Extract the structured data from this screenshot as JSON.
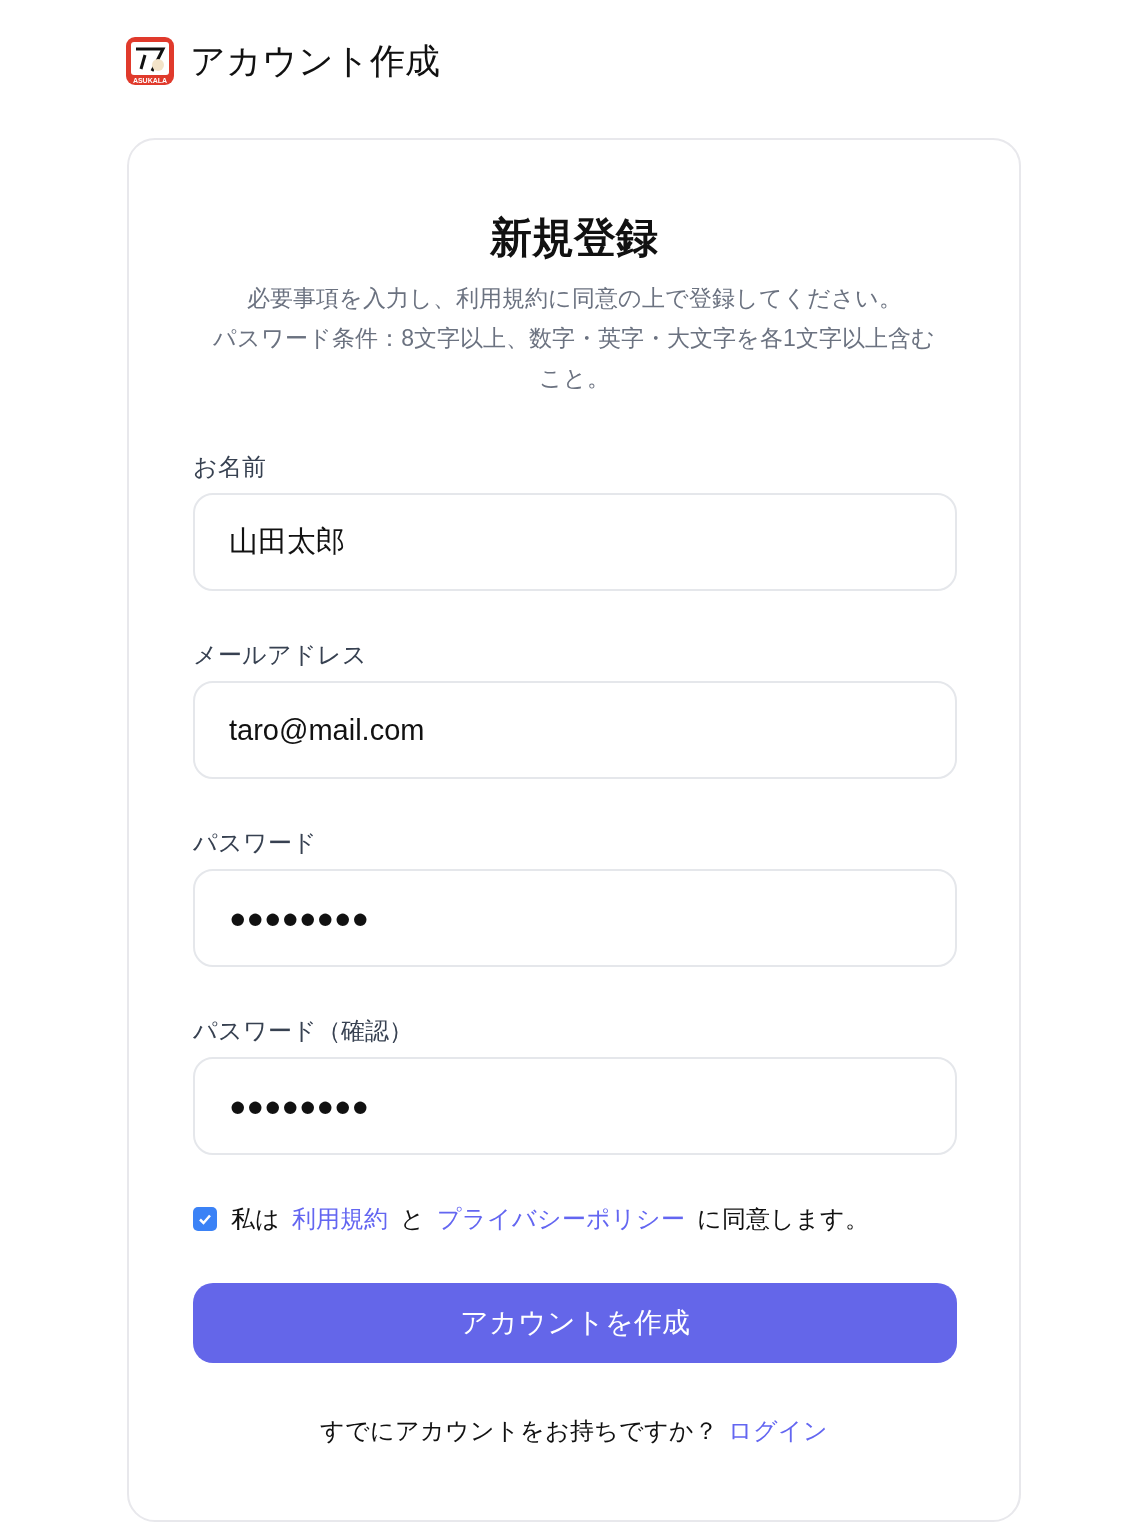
{
  "header": {
    "logo_text": "ASUKALA",
    "title": "アカウント作成"
  },
  "card": {
    "title": "新規登録",
    "subtitle_lines": [
      "必要事項を入力し、利用規約に同意の上で登録してください。",
      "パスワード条件：8文字以上、数字・英字・大文字を各1文字以上含むこと。"
    ],
    "fields": [
      {
        "label": "お名前",
        "value": "山田太郎"
      },
      {
        "label": "メールアドレス",
        "value": "taro@mail.com"
      },
      {
        "label": "パスワード",
        "value": "●●●●●●●●"
      },
      {
        "label": "パスワード（確認）",
        "value": "●●●●●●●●"
      }
    ],
    "agreement": {
      "checked": true,
      "parts": [
        {
          "kind": "text",
          "text": "私は"
        },
        {
          "kind": "link",
          "text": "利用規約"
        },
        {
          "kind": "text",
          "text": "と"
        },
        {
          "kind": "link",
          "text": "プライバシーポリシー"
        },
        {
          "kind": "text",
          "text": "に同意します。"
        }
      ]
    },
    "submit_button": "アカウントを作成",
    "footer": {
      "text": "すでにアカウントをお持ちですか？",
      "link": "ログイン"
    }
  }
}
